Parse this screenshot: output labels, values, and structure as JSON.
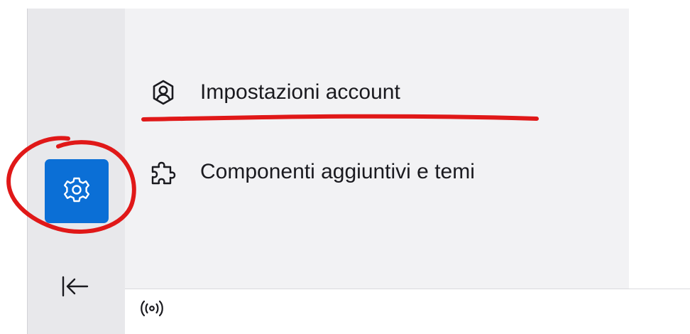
{
  "menu": {
    "items": [
      {
        "label": "Impostazioni account",
        "icon": "account-icon"
      },
      {
        "label": "Componenti aggiuntivi e temi",
        "icon": "puzzle-icon"
      }
    ]
  },
  "sidebar": {
    "settings_icon": "gear-icon",
    "collapse_icon": "collapse-left-icon"
  },
  "status_bar": {
    "activity_icon": "broadcast-icon"
  },
  "colors": {
    "accent": "#0b6fd6",
    "annotation": "#e01818"
  }
}
